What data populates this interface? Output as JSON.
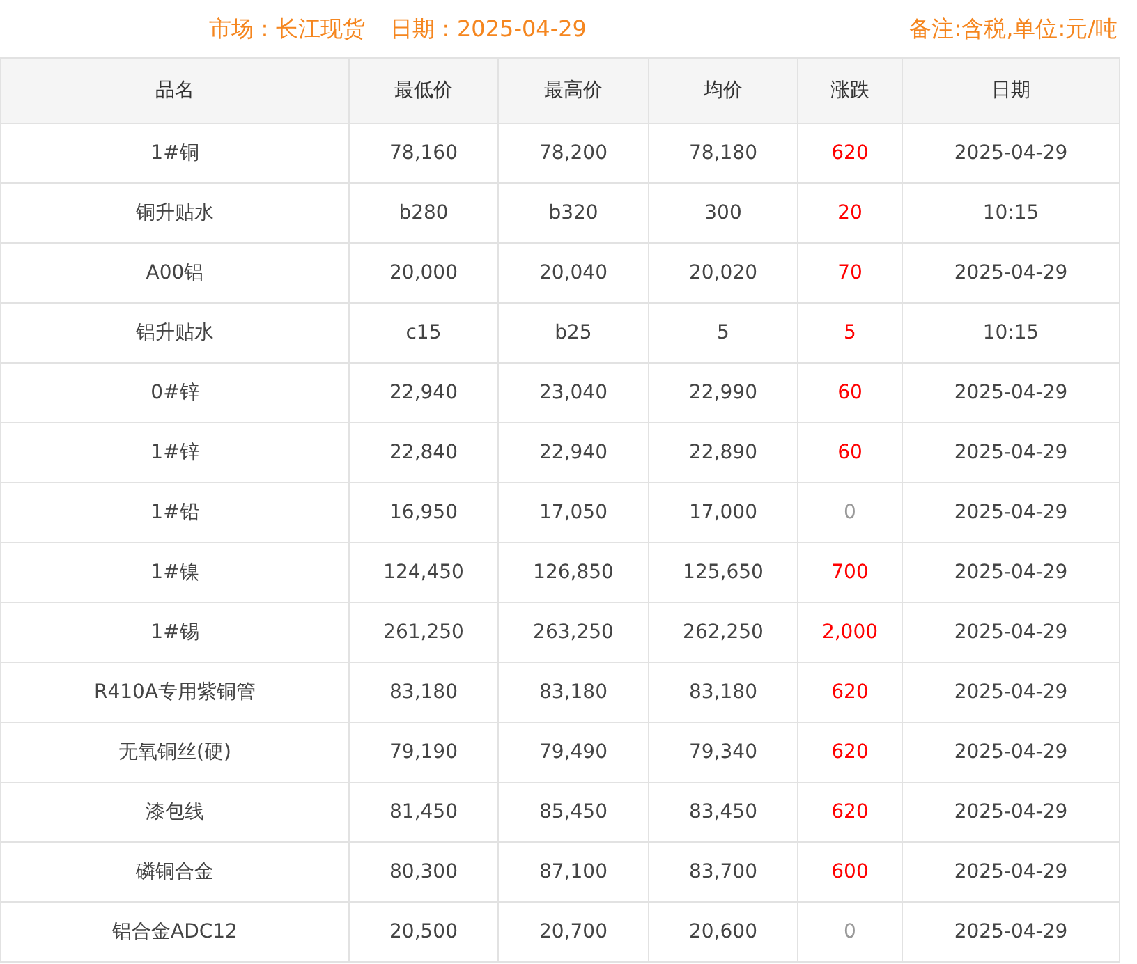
{
  "header": {
    "market": "市场：长江现货",
    "date": "日期：2025-04-29",
    "note": "备注:含税,单位:元/吨"
  },
  "table": {
    "columns": [
      "品名",
      "最低价",
      "最高价",
      "均价",
      "涨跌",
      "日期"
    ],
    "rows": [
      {
        "name": "1#铜",
        "low": "78,160",
        "high": "78,200",
        "avg": "78,180",
        "change": "620",
        "color": "#ff0000",
        "date": "2025-04-29"
      },
      {
        "name": "铜升贴水",
        "low": "b280",
        "high": "b320",
        "avg": "300",
        "change": "20",
        "color": "#ff0000",
        "date": "10:15"
      },
      {
        "name": "A00铝",
        "low": "20,000",
        "high": "20,040",
        "avg": "20,020",
        "change": "70",
        "color": "#ff0000",
        "date": "2025-04-29"
      },
      {
        "name": "铝升贴水",
        "low": "c15",
        "high": "b25",
        "avg": "5",
        "change": "5",
        "color": "#ff0000",
        "date": "10:15"
      },
      {
        "name": "0#锌",
        "low": "22,940",
        "high": "23,040",
        "avg": "22,990",
        "change": "60",
        "color": "#ff0000",
        "date": "2025-04-29"
      },
      {
        "name": "1#锌",
        "low": "22,840",
        "high": "22,940",
        "avg": "22,890",
        "change": "60",
        "color": "#ff0000",
        "date": "2025-04-29"
      },
      {
        "name": "1#铅",
        "low": "16,950",
        "high": "17,050",
        "avg": "17,000",
        "change": "0",
        "color": "#999999",
        "date": "2025-04-29"
      },
      {
        "name": "1#镍",
        "low": "124,450",
        "high": "126,850",
        "avg": "125,650",
        "change": "700",
        "color": "#ff0000",
        "date": "2025-04-29"
      },
      {
        "name": "1#锡",
        "low": "261,250",
        "high": "263,250",
        "avg": "262,250",
        "change": "2,000",
        "color": "#ff0000",
        "date": "2025-04-29"
      },
      {
        "name": "R410A专用紫铜管",
        "low": "83,180",
        "high": "83,180",
        "avg": "83,180",
        "change": "620",
        "color": "#ff0000",
        "date": "2025-04-29"
      },
      {
        "name": "无氧铜丝(硬)",
        "low": "79,190",
        "high": "79,490",
        "avg": "79,340",
        "change": "620",
        "color": "#ff0000",
        "date": "2025-04-29"
      },
      {
        "name": "漆包线",
        "low": "81,450",
        "high": "85,450",
        "avg": "83,450",
        "change": "620",
        "color": "#ff0000",
        "date": "2025-04-29"
      },
      {
        "name": "磷铜合金",
        "low": "80,300",
        "high": "87,100",
        "avg": "83,700",
        "change": "600",
        "color": "#ff0000",
        "date": "2025-04-29"
      },
      {
        "name": "铝合金ADC12",
        "low": "20,500",
        "high": "20,700",
        "avg": "20,600",
        "change": "0",
        "color": "#999999",
        "date": "2025-04-29"
      }
    ]
  }
}
